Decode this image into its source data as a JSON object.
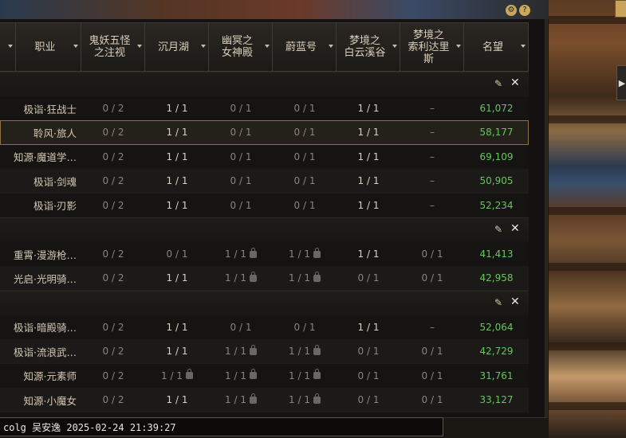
{
  "columns": [
    {
      "label": "",
      "w": 20
    },
    {
      "label": "职业",
      "w": 82
    },
    {
      "label": "鬼妖五怪\n之注视",
      "w": 80
    },
    {
      "label": "沉月湖",
      "w": 80
    },
    {
      "label": "幽冥之\n女神殿",
      "w": 80
    },
    {
      "label": "蔚蓝号",
      "w": 80
    },
    {
      "label": "梦境之\n白云溪谷",
      "w": 80
    },
    {
      "label": "梦境之\n索利达里\n斯",
      "w": 80
    },
    {
      "label": "名望",
      "w": 81
    }
  ],
  "groups": [
    {
      "rows": [
        {
          "job": "极诣·狂战士",
          "c": [
            "0 / 2",
            "1 / 1",
            "0 / 1",
            "0 / 1",
            "1 / 1",
            "–"
          ],
          "fame": "61,072"
        },
        {
          "job": "聆风·旅人",
          "c": [
            "0 / 2",
            "1 / 1",
            "0 / 1",
            "0 / 1",
            "1 / 1",
            "–"
          ],
          "fame": "58,177",
          "selected": true
        },
        {
          "job": "知源·魔道学…",
          "c": [
            "0 / 2",
            "1 / 1",
            "0 / 1",
            "0 / 1",
            "1 / 1",
            "–"
          ],
          "fame": "69,109"
        },
        {
          "job": "极诣·剑魂",
          "c": [
            "0 / 2",
            "1 / 1",
            "0 / 1",
            "0 / 1",
            "1 / 1",
            "–"
          ],
          "fame": "50,905"
        },
        {
          "job": "极诣·刃影",
          "c": [
            "0 / 2",
            "1 / 1",
            "0 / 1",
            "0 / 1",
            "1 / 1",
            "–"
          ],
          "fame": "52,234"
        }
      ]
    },
    {
      "rows": [
        {
          "job": "重霄·漫游枪…",
          "c": [
            "0 / 2",
            "0 / 1",
            "1 / 1",
            "1 / 1",
            "1 / 1",
            "0 / 1"
          ],
          "fame": "41,413",
          "locks": [
            2,
            3
          ]
        },
        {
          "job": "光启·光明骑…",
          "c": [
            "0 / 2",
            "1 / 1",
            "1 / 1",
            "1 / 1",
            "0 / 1",
            "0 / 1"
          ],
          "fame": "42,958",
          "locks": [
            2,
            3
          ]
        }
      ]
    },
    {
      "rows": [
        {
          "job": "极诣·暗殿骑…",
          "c": [
            "0 / 2",
            "1 / 1",
            "0 / 1",
            "0 / 1",
            "1 / 1",
            "–"
          ],
          "fame": "52,064"
        },
        {
          "job": "极诣·流浪武…",
          "c": [
            "0 / 2",
            "1 / 1",
            "1 / 1",
            "1 / 1",
            "0 / 1",
            "0 / 1"
          ],
          "fame": "42,729",
          "locks": [
            2,
            3
          ]
        },
        {
          "job": "知源·元素师",
          "c": [
            "0 / 2",
            "1 / 1",
            "1 / 1",
            "1 / 1",
            "0 / 1",
            "0 / 1"
          ],
          "fame": "31,761",
          "locks": [
            1,
            2,
            3
          ]
        },
        {
          "job": "知源·小魔女",
          "c": [
            "0 / 2",
            "1 / 1",
            "1 / 1",
            "1 / 1",
            "0 / 1",
            "0 / 1"
          ],
          "fame": "33,127",
          "locks": [
            2,
            3
          ]
        }
      ]
    }
  ],
  "status_text": "colg 吴安逸 2025-02-24 21:39:27",
  "icons": {
    "edit": "pencil-icon",
    "close": "close-icon"
  },
  "colors": {
    "fame": "#67c65a",
    "highlight": "#8a7240"
  }
}
